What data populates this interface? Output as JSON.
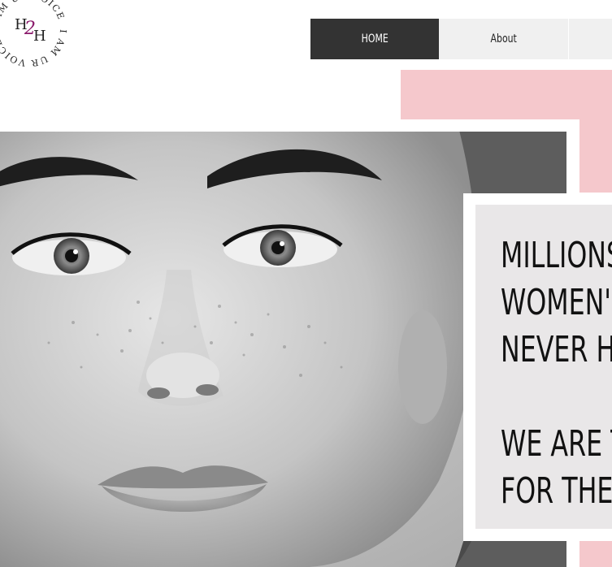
{
  "logo": {
    "ring_text_top": "I AM UR VOICE",
    "ring_text_bottom": "I AM UR VOICE",
    "monogram": "H2H",
    "colors": {
      "ink": "#222222",
      "accent": "#8a1a6b"
    }
  },
  "nav": {
    "items": [
      {
        "label": "HOME",
        "active": true
      },
      {
        "label": "About",
        "active": false
      }
    ]
  },
  "hero": {
    "image": "black-and-white close-up portrait of a woman's face",
    "headline_lines": [
      "MILLIONS",
      "WOMEN'S",
      "NEVER HE"
    ],
    "subline_lines": [
      "WE ARE T",
      "FOR THE"
    ]
  },
  "colors": {
    "pink": "#f5c8cc",
    "nav_active": "#333333",
    "nav_inactive": "#f0f0f0",
    "card": "#e9e7e8"
  }
}
